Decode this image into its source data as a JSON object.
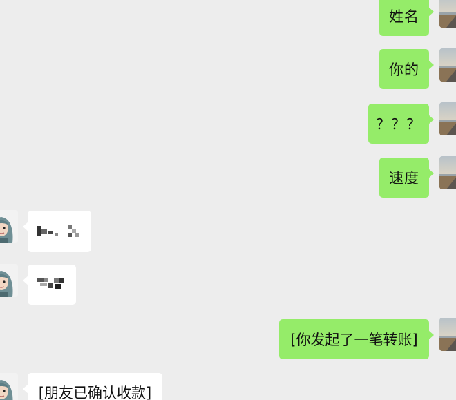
{
  "conversation": {
    "my_messages": {
      "m1": "姓名",
      "m2": "你的",
      "m3": "？？？",
      "m4": "速度",
      "m5": "[你发起了一笔转账]"
    },
    "friend_messages": {
      "f1": "",
      "f2": "",
      "f3": "[朋友已确认收款]"
    }
  },
  "avatars": {
    "me": "road-landscape-avatar-icon",
    "friend": "cartoon-girl-avatar-icon"
  },
  "colors": {
    "background": "#ededed",
    "my_bubble": "#95ec69",
    "friend_bubble": "#ffffff",
    "text": "#111111"
  }
}
